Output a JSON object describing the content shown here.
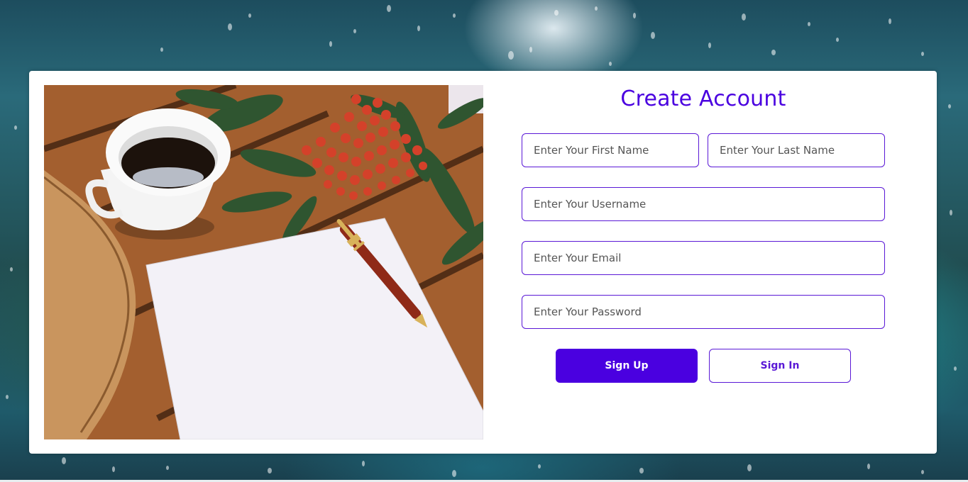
{
  "form": {
    "title": "Create Account",
    "first_name_placeholder": "Enter Your First Name",
    "last_name_placeholder": "Enter Your Last Name",
    "username_placeholder": "Enter Your Username",
    "email_placeholder": "Enter Your Email",
    "password_placeholder": "Enter Your Password",
    "signup_label": "Sign Up",
    "signin_label": "Sign In"
  },
  "colors": {
    "accent": "#4a00e0",
    "border": "#5a18d6",
    "card": "#ffffff"
  },
  "illustration": {
    "description_icon": "coffee-paper-pen-photo"
  }
}
